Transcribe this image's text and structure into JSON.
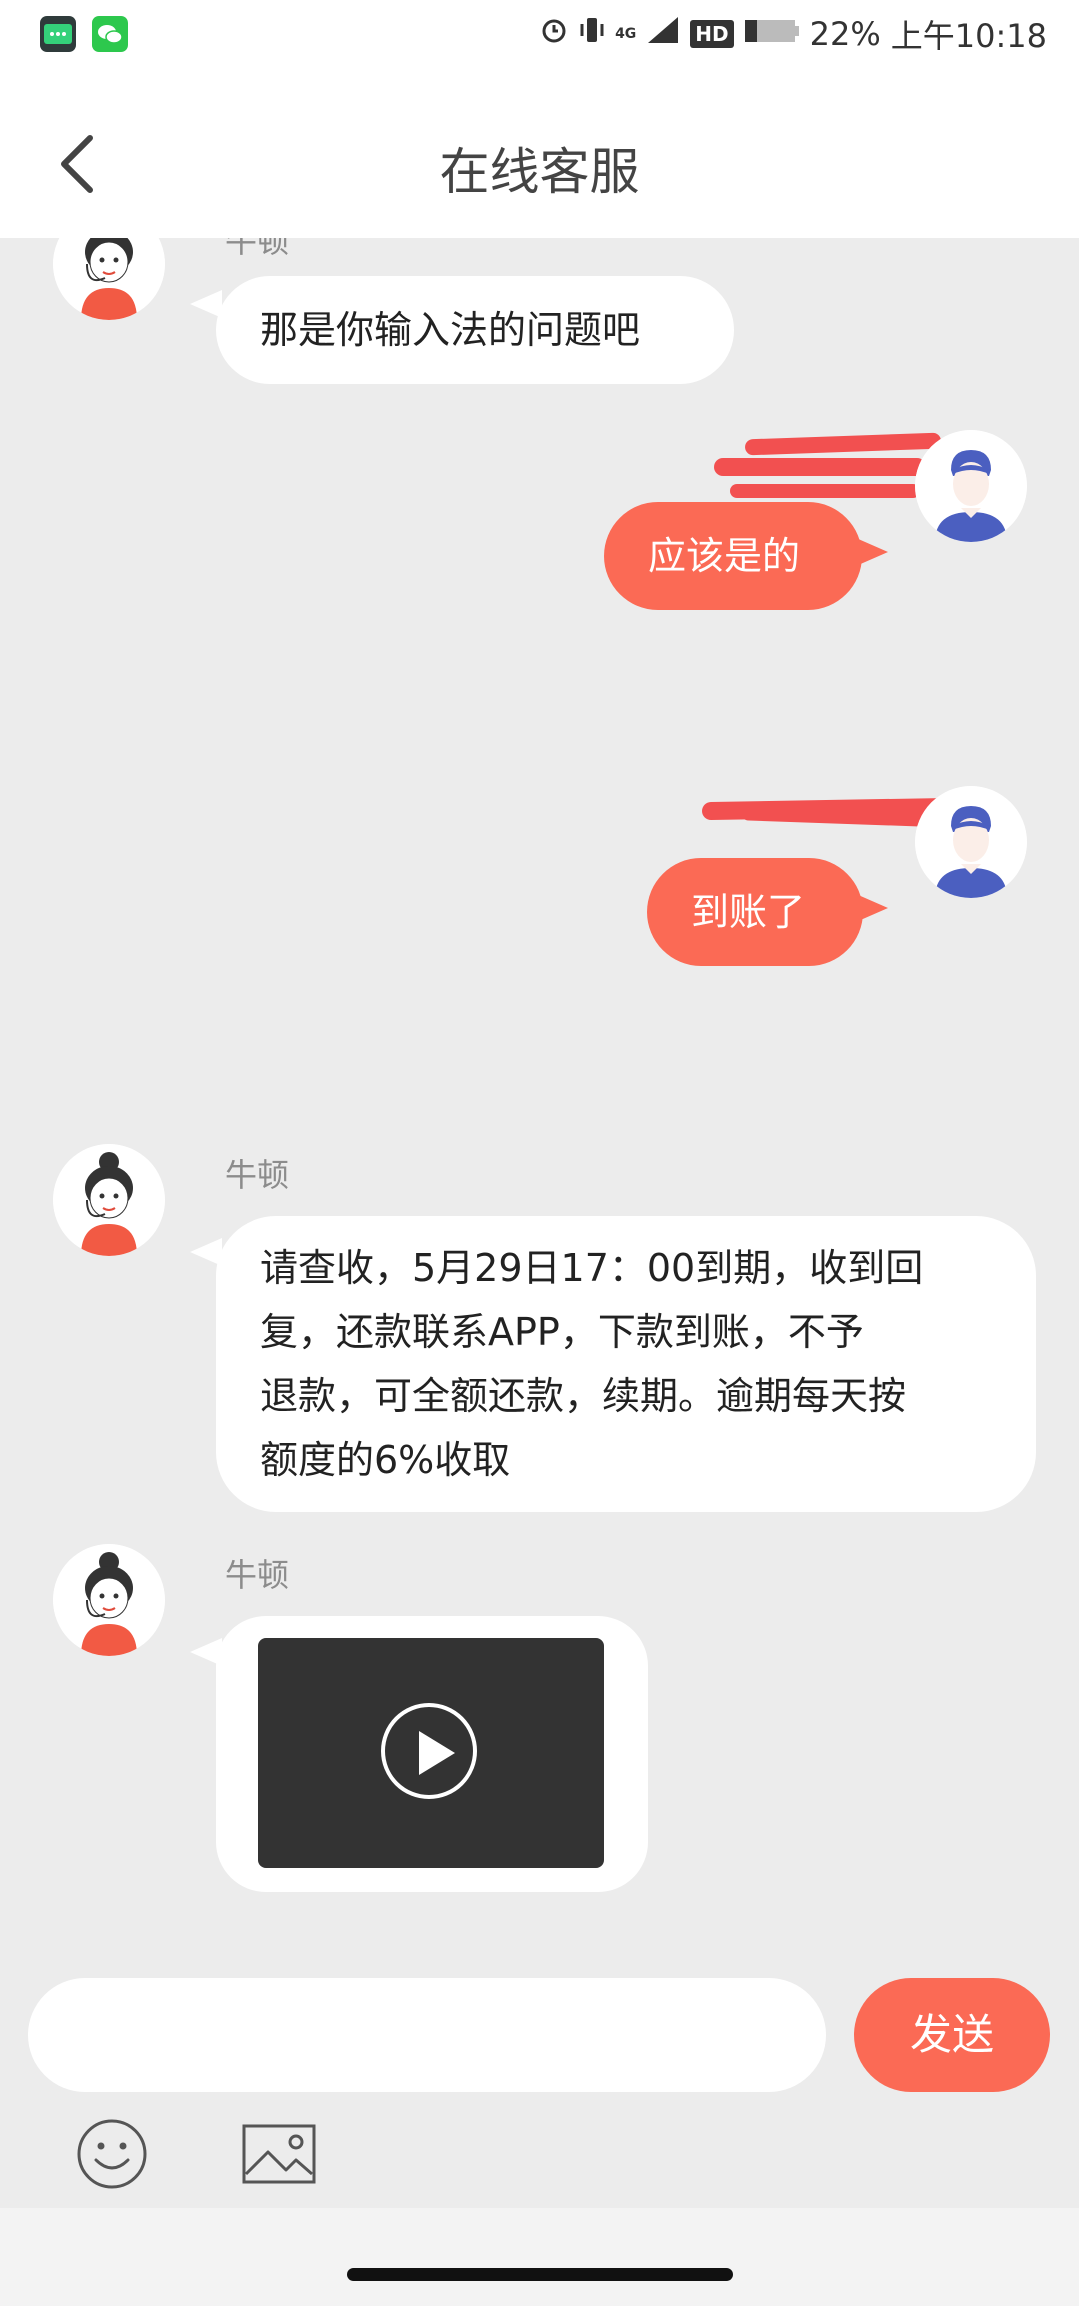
{
  "status_bar": {
    "battery_percent": "22%",
    "time": "上午10:18",
    "network": "4G",
    "hd_label": "HD"
  },
  "header": {
    "title": "在线客服"
  },
  "messages": [
    {
      "side": "left",
      "sender": "牛顿",
      "text": "那是你输入法的问题吧"
    },
    {
      "side": "right",
      "text": "应该是的"
    },
    {
      "side": "right",
      "text": "到账了"
    },
    {
      "side": "left",
      "sender": "牛顿",
      "lines": [
        "请查收，5月29日17：00到期，收到回",
        "复，还款联系APP，下款到账，不予",
        "退款，可全额还款，续期。逾期每天按",
        "额度的6%收取"
      ]
    },
    {
      "side": "left",
      "sender": "牛顿",
      "type": "video"
    }
  ],
  "input": {
    "placeholder": "",
    "send_label": "发送"
  },
  "icons": {
    "emoji": "smiley-icon",
    "image": "image-icon",
    "back": "back-arrow-icon",
    "play": "play-icon"
  },
  "colors": {
    "accent": "#fb6a55",
    "background": "#ececec"
  }
}
